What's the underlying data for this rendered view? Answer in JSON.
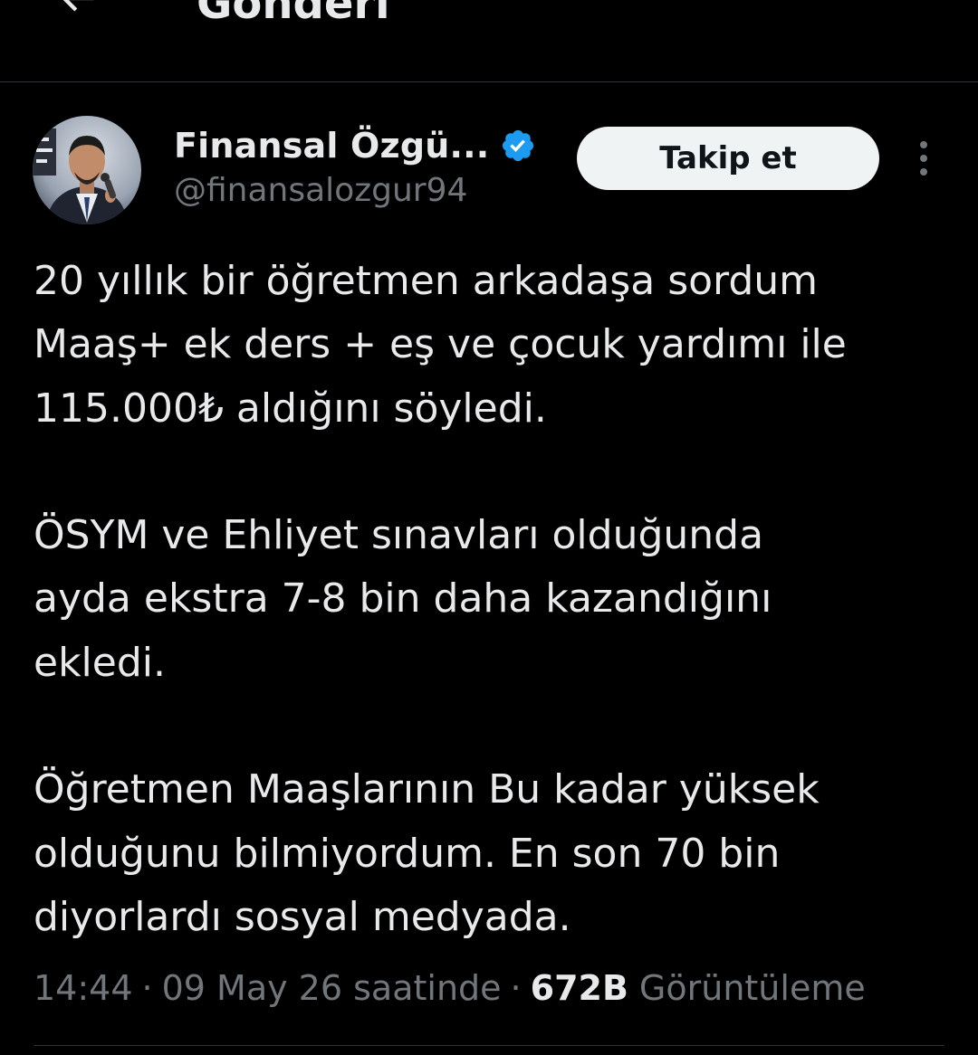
{
  "header": {
    "title": "Gönderi",
    "back_icon": "arrow-left-icon"
  },
  "author": {
    "display_name": "Finansal Özgü...",
    "handle": "@finansalozgur94",
    "verified_icon": "verified-badge-icon",
    "verified_color": "#1d9bf0"
  },
  "actions": {
    "follow_label": "Takip et",
    "more_icon": "more-vertical-icon"
  },
  "tweet": {
    "lines": [
      "20 yıllık bir öğretmen arkadaşa sordum",
      "Maaş+ ek ders + eş ve çocuk yardımı ile",
      "115.000₺ aldığını söyledi.",
      "",
      "ÖSYM ve Ehliyet sınavları olduğunda",
      "ayda ekstra 7-8 bin daha kazandığını",
      "ekledi.",
      "",
      "Öğretmen Maaşlarının Bu kadar yüksek",
      "olduğunu bilmiyordum. En son 70 bin",
      "diyorlardı sosyal medyada."
    ]
  },
  "meta": {
    "time": "14:44",
    "separator": "·",
    "date": "09 May 26 saatinde",
    "views_count": "672B",
    "views_label": "Görüntüleme"
  },
  "colors": {
    "background": "#000000",
    "text": "#e7e9ea",
    "secondary_text": "#71767b",
    "divider": "#2f3336",
    "follow_bg": "#eff3f4"
  }
}
